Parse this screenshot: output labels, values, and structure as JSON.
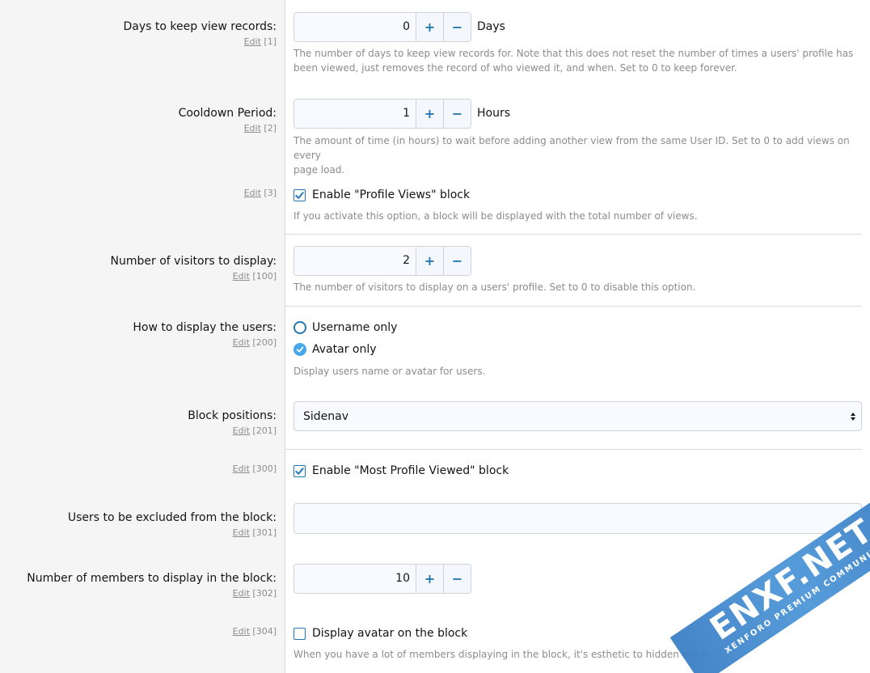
{
  "options": [
    {
      "label": "Days to keep view records:",
      "edit": "Edit",
      "id": "[1]",
      "value": "0",
      "unit": "Days",
      "hint_line1": "The number of days to keep view records for. Note that this does not reset the number of times a users' profile has",
      "hint_line2": "been viewed, just removes the record of who viewed it, and when. Set to 0 to keep forever."
    },
    {
      "label": "Cooldown Period:",
      "edit": "Edit",
      "id": "[2]",
      "value": "1",
      "unit": "Hours",
      "hint_line1": "The amount of time (in hours) to wait before adding another view from the same User ID. Set to 0 to add views on every",
      "hint_line2": "page load."
    },
    {
      "edit": "Edit",
      "id": "[3]",
      "checkbox_label": "Enable \"Profile Views\" block",
      "checked": true,
      "hint": "If you activate this option, a block will be displayed with the total number of views."
    },
    {
      "label": "Number of visitors to display:",
      "edit": "Edit",
      "id": "[100]",
      "value": "2",
      "hint": "The number of visitors to display on a users' profile. Set to 0 to disable this option."
    },
    {
      "label": "How to display the users:",
      "edit": "Edit",
      "id": "[200]",
      "radio_options": [
        {
          "label": "Username only",
          "selected": false
        },
        {
          "label": "Avatar only",
          "selected": true
        }
      ],
      "hint": "Display users name or avatar for users."
    },
    {
      "label": "Block positions:",
      "edit": "Edit",
      "id": "[201]",
      "selected": "Sidenav"
    },
    {
      "edit": "Edit",
      "id": "[300]",
      "checkbox_label": "Enable \"Most Profile Viewed\" block",
      "checked": true
    },
    {
      "label": "Users to be excluded from the block:",
      "edit": "Edit",
      "id": "[301]",
      "value": ""
    },
    {
      "label": "Number of members to display in the block:",
      "edit": "Edit",
      "id": "[302]",
      "value": "10"
    },
    {
      "edit": "Edit",
      "id": "[304]",
      "checkbox_label": "Display avatar on the block",
      "checked": false,
      "hint": "When you have a lot of members displaying in the block, it's esthetic to hidden the a"
    }
  ],
  "watermark": {
    "main": "ENXF.NET",
    "sub": "XENFORO PREMIUM COMMUNITY"
  },
  "colors": {
    "accent": "#2577b1",
    "radio_selected": "#47a7eb",
    "label_bg": "#f5f5f5",
    "hint": "#8c8c8c"
  }
}
